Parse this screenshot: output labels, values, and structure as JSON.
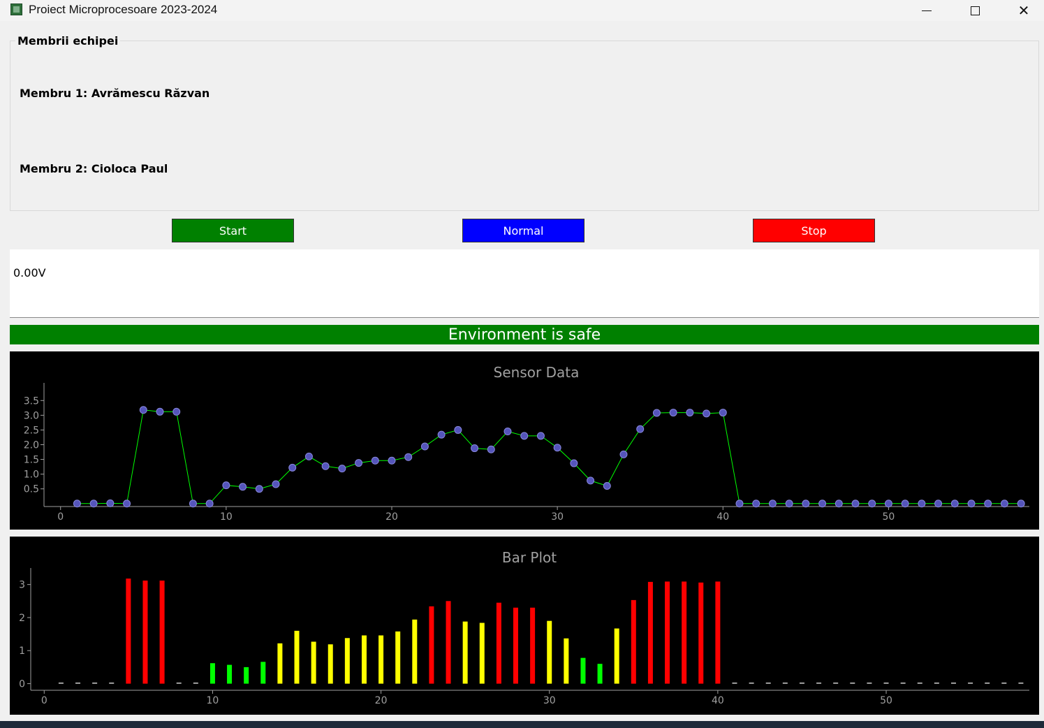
{
  "window": {
    "title": "Proiect Microprocesoare 2023-2024",
    "icon": "chip-icon",
    "controls": [
      "minimize-icon",
      "maximize-icon",
      "close-icon"
    ]
  },
  "team": {
    "group_title": "Membrii echipei",
    "member1": "Membru 1: Avrămescu Răzvan",
    "member2": "Membru 2: Cioloca Paul"
  },
  "buttons": {
    "start": "Start",
    "normal": "Normal",
    "stop": "Stop",
    "colors": {
      "start": "#008000",
      "normal": "#0000ff",
      "stop": "#ff0000"
    }
  },
  "voltage": {
    "text": "0.00V"
  },
  "status": {
    "text": "Environment is safe",
    "color": "#008000"
  },
  "chart_data": [
    {
      "type": "line",
      "title": "Sensor Data",
      "xlim": [
        -1,
        58.5
      ],
      "ylim": [
        -0.1,
        4.1
      ],
      "x_ticks": [
        0,
        10,
        20,
        30,
        40,
        50
      ],
      "y_ticks": [
        0.5,
        1.0,
        1.5,
        2.0,
        2.5,
        3.0,
        3.5
      ],
      "line_color": "#00ff00",
      "marker_color": "#5555bb",
      "background": "#000000",
      "x": [
        1,
        2,
        3,
        4,
        5,
        6,
        7,
        8,
        9,
        10,
        11,
        12,
        13,
        14,
        15,
        16,
        17,
        18,
        19,
        20,
        21,
        22,
        23,
        24,
        25,
        26,
        27,
        28,
        29,
        30,
        31,
        32,
        33,
        34,
        35,
        36,
        37,
        38,
        39,
        40,
        41,
        42,
        43,
        44,
        45,
        46,
        47,
        48,
        49,
        50,
        51,
        52,
        53,
        54,
        55,
        56,
        57,
        58
      ],
      "y": [
        0,
        0,
        0.01,
        0,
        3.18,
        3.12,
        3.12,
        0,
        0,
        0.62,
        0.57,
        0.5,
        0.66,
        1.22,
        1.6,
        1.27,
        1.19,
        1.38,
        1.46,
        1.46,
        1.58,
        1.94,
        2.34,
        2.5,
        1.88,
        1.84,
        2.45,
        2.3,
        2.3,
        1.9,
        1.37,
        0.78,
        0.6,
        1.67,
        2.53,
        3.08,
        3.09,
        3.09,
        3.06,
        3.09,
        0,
        0,
        0,
        0,
        0,
        0,
        0,
        0,
        0,
        0,
        0,
        0,
        0,
        0,
        0,
        0,
        0,
        0
      ]
    },
    {
      "type": "bar",
      "title": "Bar Plot",
      "xlim": [
        -0.8,
        58.5
      ],
      "ylim": [
        -0.2,
        3.5
      ],
      "x_ticks": [
        0,
        10,
        20,
        30,
        40,
        50
      ],
      "y_ticks": [
        0,
        1,
        2,
        3
      ],
      "background": "#000000",
      "thresholds": {
        "green_below": 0.9,
        "yellow_below": 2.0
      },
      "colors": {
        "low": "#00ff00",
        "mid": "#ffff00",
        "high": "#ff0000",
        "zero": "#d0d0d0"
      },
      "x": [
        1,
        2,
        3,
        4,
        5,
        6,
        7,
        8,
        9,
        10,
        11,
        12,
        13,
        14,
        15,
        16,
        17,
        18,
        19,
        20,
        21,
        22,
        23,
        24,
        25,
        26,
        27,
        28,
        29,
        30,
        31,
        32,
        33,
        34,
        35,
        36,
        37,
        38,
        39,
        40,
        41,
        42,
        43,
        44,
        45,
        46,
        47,
        48,
        49,
        50,
        51,
        52,
        53,
        54,
        55,
        56,
        57,
        58
      ],
      "values": [
        0.02,
        0.02,
        0.02,
        0.02,
        3.18,
        3.12,
        3.12,
        0.02,
        0.02,
        0.62,
        0.57,
        0.5,
        0.66,
        1.22,
        1.6,
        1.27,
        1.19,
        1.38,
        1.46,
        1.46,
        1.58,
        1.94,
        2.34,
        2.5,
        1.88,
        1.84,
        2.45,
        2.3,
        2.3,
        1.9,
        1.37,
        0.78,
        0.6,
        1.67,
        2.53,
        3.08,
        3.09,
        3.09,
        3.06,
        3.09,
        0.02,
        0.02,
        0.02,
        0.02,
        0.02,
        0.02,
        0.02,
        0.02,
        0.02,
        0.02,
        0.02,
        0.02,
        0.02,
        0.02,
        0.02,
        0.02,
        0.02,
        0.02
      ]
    }
  ]
}
